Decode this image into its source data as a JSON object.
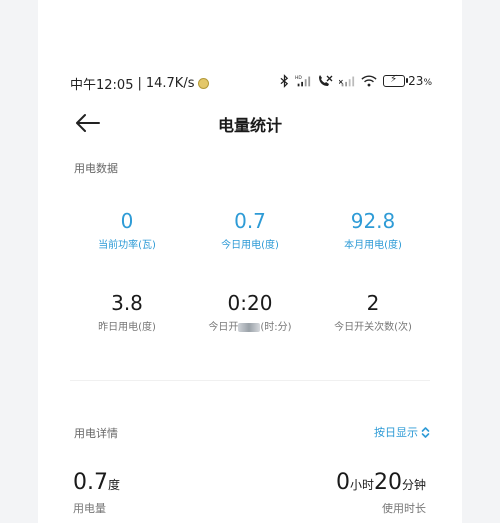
{
  "status_bar": {
    "time": "中午12:05",
    "separator": "|",
    "speed": "14.7K/s",
    "battery_pct": "23",
    "battery_pct_suffix": "%",
    "icons": [
      "bluetooth-icon",
      "hd-signal-icon",
      "call-icon",
      "signal-icon",
      "wifi-icon",
      "battery-icon"
    ]
  },
  "header": {
    "title": "电量统计"
  },
  "power_data": {
    "section_label": "用电数据",
    "row1": [
      {
        "value": "0",
        "label": "当前功率(瓦)"
      },
      {
        "value": "0.7",
        "label": "今日用电(度)"
      },
      {
        "value": "92.8",
        "label": "本月用电(度)"
      }
    ],
    "row2": [
      {
        "value": "3.8",
        "label": "昨日用电(度)"
      },
      {
        "value": "0:20",
        "label_prefix": "今日开",
        "label_suffix": "(时:分)"
      },
      {
        "value": "2",
        "label": "今日开关次数(次)"
      }
    ]
  },
  "detail": {
    "section_label": "用电详情",
    "mode_label": "按日显示",
    "usage_value": "0.7",
    "usage_unit": "度",
    "usage_label": "用电量",
    "duration_hours": "0",
    "duration_hours_unit": "小时",
    "duration_minutes": "20",
    "duration_minutes_unit": "分钟",
    "duration_label": "使用时长"
  },
  "colors": {
    "accent": "#2e9bd6",
    "background": "#ffffff",
    "page": "#f3f4f6"
  }
}
